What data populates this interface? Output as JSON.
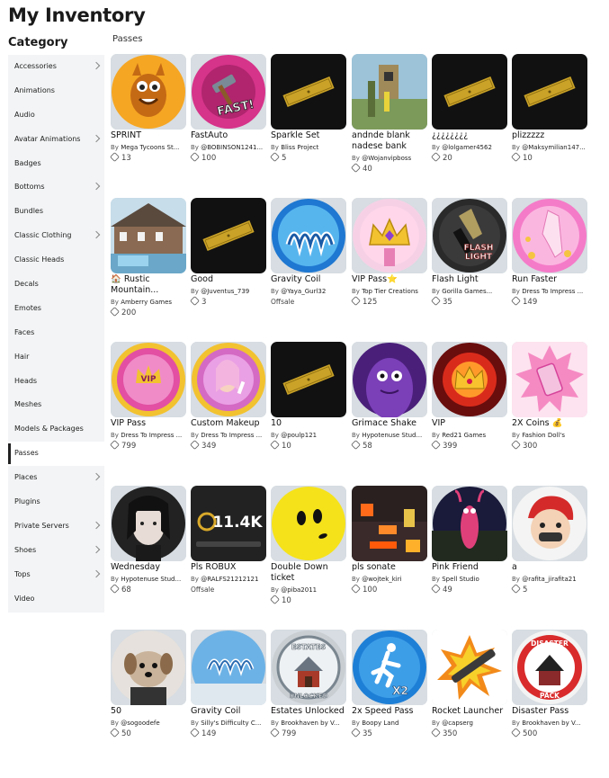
{
  "page": {
    "title": "My Inventory",
    "category_heading": "Category",
    "section": "Passes"
  },
  "sidebar": {
    "items": [
      {
        "label": "Accessories",
        "chevron": true
      },
      {
        "label": "Animations",
        "chevron": false
      },
      {
        "label": "Audio",
        "chevron": false
      },
      {
        "label": "Avatar Animations",
        "chevron": true
      },
      {
        "label": "Badges",
        "chevron": false
      },
      {
        "label": "Bottoms",
        "chevron": true
      },
      {
        "label": "Bundles",
        "chevron": false
      },
      {
        "label": "Classic Clothing",
        "chevron": true
      },
      {
        "label": "Classic Heads",
        "chevron": false
      },
      {
        "label": "Decals",
        "chevron": false
      },
      {
        "label": "Emotes",
        "chevron": false
      },
      {
        "label": "Faces",
        "chevron": false
      },
      {
        "label": "Hair",
        "chevron": false
      },
      {
        "label": "Heads",
        "chevron": false
      },
      {
        "label": "Meshes",
        "chevron": false
      },
      {
        "label": "Models & Packages",
        "chevron": false
      },
      {
        "label": "Passes",
        "chevron": false,
        "active": true
      },
      {
        "label": "Places",
        "chevron": true
      },
      {
        "label": "Plugins",
        "chevron": false
      },
      {
        "label": "Private Servers",
        "chevron": true
      },
      {
        "label": "Shoes",
        "chevron": true
      },
      {
        "label": "Tops",
        "chevron": true
      },
      {
        "label": "Video",
        "chevron": false
      }
    ]
  },
  "items": [
    {
      "name": "SPRINT",
      "by": "By",
      "creator": "Mega Tycoons St...",
      "price": "13",
      "thumb": "orange-creature"
    },
    {
      "name": "FastAuto",
      "by": "By",
      "creator": "@BOBINSON1241...",
      "price": "100",
      "thumb": "fast-hammer"
    },
    {
      "name": "Sparkle Set",
      "by": "By",
      "creator": "Bliss Project",
      "price": "5",
      "thumb": "gold-ticket"
    },
    {
      "name": "andnde blank nadese bank",
      "by": "By",
      "creator": "@Wojanvipboss",
      "price": "40",
      "thumb": "game-scene"
    },
    {
      "name": "¿¿¿¿¿¿¿¿",
      "by": "By",
      "creator": "@lolgamer4562",
      "price": "20",
      "thumb": "gold-ticket"
    },
    {
      "name": "plizzzzz",
      "by": "By",
      "creator": "@Maksymilian147...",
      "price": "10",
      "thumb": "gold-ticket"
    },
    {
      "name": "🏠 Rustic Mountain...",
      "by": "By",
      "creator": "Amberry Games",
      "price": "200",
      "thumb": "house"
    },
    {
      "name": "Good",
      "by": "By",
      "creator": "@Juventus_739",
      "price": "3",
      "thumb": "gold-ticket"
    },
    {
      "name": "Gravity Coil",
      "by": "By",
      "creator": "@Yaya_Gurl32",
      "price": "",
      "offsale": "Offsale",
      "thumb": "blue-coil"
    },
    {
      "name": "VIP Pass⭐",
      "by": "By",
      "creator": "Top Tier Creations",
      "price": "125",
      "thumb": "vip-crown"
    },
    {
      "name": "Flash Light",
      "by": "By",
      "creator": "Gorilla Games...",
      "price": "35",
      "thumb": "flashlight"
    },
    {
      "name": "Run Faster",
      "by": "By",
      "creator": "Dress To Impress ...",
      "price": "149",
      "thumb": "pink-heel"
    },
    {
      "name": "VIP Pass",
      "by": "By",
      "creator": "Dress To Impress ...",
      "price": "799",
      "thumb": "vip-pink"
    },
    {
      "name": "Custom Makeup",
      "by": "By",
      "creator": "Dress To Impress ...",
      "price": "349",
      "thumb": "makeup"
    },
    {
      "name": "10",
      "by": "By",
      "creator": "@poulp121",
      "price": "10",
      "thumb": "gold-ticket"
    },
    {
      "name": "Grimace Shake",
      "by": "By",
      "creator": "Hypotenuse Stud...",
      "price": "58",
      "thumb": "grimace"
    },
    {
      "name": "VIP",
      "by": "By",
      "creator": "Red21 Games",
      "price": "399",
      "thumb": "red-crown"
    },
    {
      "name": "2X Coins 💰",
      "by": "By",
      "creator": "Fashion Doll's",
      "price": "300",
      "thumb": "pink-phone"
    },
    {
      "name": "Wednesday",
      "by": "By",
      "creator": "Hypotenuse Stud...",
      "price": "68",
      "thumb": "wednesday"
    },
    {
      "name": "Pls ROBUX",
      "by": "By",
      "creator": "@RALFS21212121",
      "price": "",
      "offsale": "Offsale",
      "thumb": "robux-11k"
    },
    {
      "name": "Double Down ticket",
      "by": "By",
      "creator": "@piba2011",
      "price": "10",
      "thumb": "yellow-face"
    },
    {
      "name": "pls sonate",
      "by": "By",
      "creator": "@wojtek_kiri",
      "price": "100",
      "thumb": "lava-scene"
    },
    {
      "name": "Pink Friend",
      "by": "By",
      "creator": "Spell Studio",
      "price": "49",
      "thumb": "pink-friend"
    },
    {
      "name": "a",
      "by": "By",
      "creator": "@rafita_jirafita21",
      "price": "5",
      "thumb": "cartoon-boy"
    },
    {
      "name": "50",
      "by": "By",
      "creator": "@sogoodefe",
      "price": "50",
      "thumb": "puppy"
    },
    {
      "name": "Gravity Coil",
      "by": "By",
      "creator": "Silly's Difficulty C...",
      "price": "149",
      "thumb": "coil-sky"
    },
    {
      "name": "Estates Unlocked",
      "by": "By",
      "creator": "Brookhaven by V...",
      "price": "799",
      "thumb": "estates"
    },
    {
      "name": "2x Speed Pass",
      "by": "By",
      "creator": "Boopy Land",
      "price": "35",
      "thumb": "speed"
    },
    {
      "name": "Rocket Launcher",
      "by": "By",
      "creator": "@capserg",
      "price": "350",
      "thumb": "rocket"
    },
    {
      "name": "Disaster Pass",
      "by": "By",
      "creator": "Brookhaven by V...",
      "price": "500",
      "thumb": "disaster"
    }
  ],
  "thumb_text": {
    "fast": "FAST!",
    "flashlight": "FLASH LIGHT",
    "robux": "11.4K",
    "estates_top": "ESTATES",
    "estates_bottom": "UNLOCKED",
    "speed": "X2",
    "disaster_top": "DISASTER",
    "disaster_bottom": "PACK",
    "vip": "VIP"
  },
  "colors": {
    "sidebar_bg": "#f2f4f5",
    "thumb_bg": "#d7dde2",
    "text": "#1a1a1a"
  }
}
